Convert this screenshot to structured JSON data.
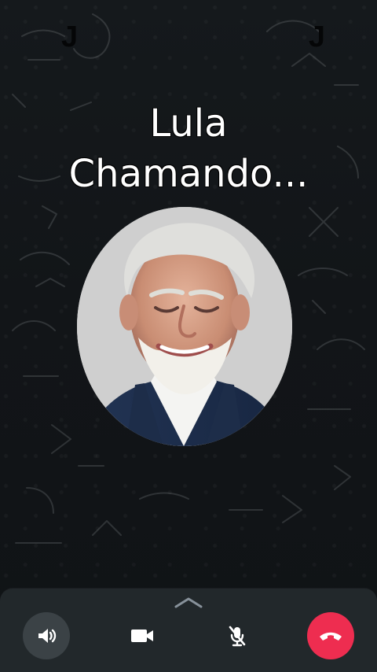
{
  "corner_marks": {
    "left": "J",
    "right": "J"
  },
  "call": {
    "caller_name": "Lula",
    "status": "Chamando..."
  },
  "controls": {
    "speaker": "speaker",
    "video": "video",
    "mute": "microphone-muted",
    "end_call": "end-call"
  },
  "colors": {
    "background": "#111417",
    "panel": "#22282b",
    "end_call": "#ee2d50",
    "text": "#ffffff"
  }
}
